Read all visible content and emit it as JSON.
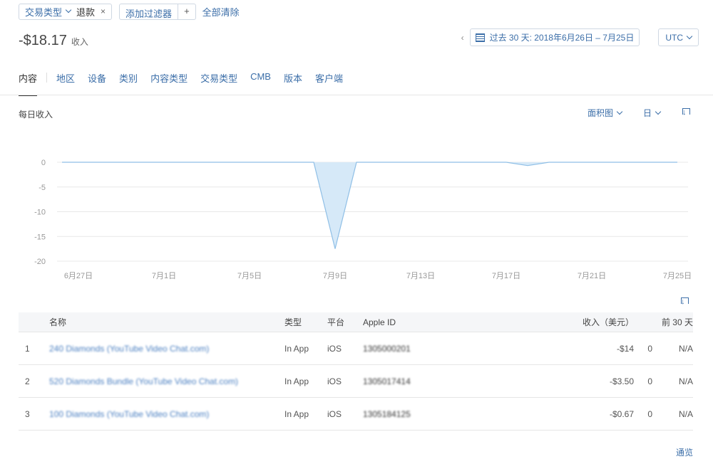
{
  "filters": {
    "chip_label": "交易类型",
    "chip_value": "退款",
    "add_filter_label": "添加过滤器",
    "add_plus": "+",
    "clear_all": "全部清除"
  },
  "summary": {
    "amount": "-$18.17",
    "unit": "收入"
  },
  "date_range": {
    "label": "过去 30 天: 2018年6月26日 – 7月25日",
    "timezone": "UTC"
  },
  "tabs": [
    "内容",
    "地区",
    "设备",
    "类别",
    "内容类型",
    "交易类型",
    "CMB",
    "版本",
    "客户端"
  ],
  "chart_header": {
    "title": "每日收入",
    "chart_type_label": "面积图",
    "granularity_label": "日"
  },
  "chart_data": {
    "type": "area",
    "y_ticks": [
      0,
      -5,
      -10,
      -15,
      -20
    ],
    "ylim": [
      -20,
      0
    ],
    "x_tick_labels": [
      "6月27日",
      "7月1日",
      "7月5日",
      "7月9日",
      "7月13日",
      "7月17日",
      "7月21日",
      "7月25日"
    ],
    "x_tick_days": [
      1,
      5,
      9,
      13,
      17,
      21,
      25,
      29
    ],
    "series": [
      {
        "values": [
          0,
          0,
          0,
          0,
          0,
          0,
          0,
          0,
          0,
          0,
          0,
          0,
          0,
          -17.5,
          0,
          0,
          0,
          0,
          0,
          0,
          0,
          0,
          -0.67,
          0,
          0,
          0,
          0,
          0,
          0,
          0
        ],
        "color": "#8fbfe6",
        "fill": "#d6e9f8"
      }
    ],
    "grid": true
  },
  "table": {
    "headers": {
      "idx": "",
      "name": "名称",
      "type": "类型",
      "platform": "平台",
      "apple_id": "Apple ID",
      "revenue": "收入（美元）",
      "n": "",
      "prev": "前 30 天"
    },
    "rows": [
      {
        "idx": "1",
        "name": "240 Diamonds (YouTube Video Chat.com)",
        "type": "In App",
        "platform": "iOS",
        "apple_id": "1305000201",
        "revenue": "-$14",
        "n": "0",
        "prev": "N/A"
      },
      {
        "idx": "2",
        "name": "520 Diamonds Bundle (YouTube Video Chat.com)",
        "type": "In App",
        "platform": "iOS",
        "apple_id": "1305017414",
        "revenue": "-$3.50",
        "n": "0",
        "prev": "N/A"
      },
      {
        "idx": "3",
        "name": "100 Diamonds (YouTube Video Chat.com)",
        "type": "In App",
        "platform": "iOS",
        "apple_id": "1305184125",
        "revenue": "-$0.67",
        "n": "0",
        "prev": "N/A"
      }
    ]
  },
  "overview_link": "通览",
  "colors": {
    "accent": "#3b6ea8",
    "area_fill": "#d6e9f8",
    "area_line": "#8fbfe6"
  }
}
